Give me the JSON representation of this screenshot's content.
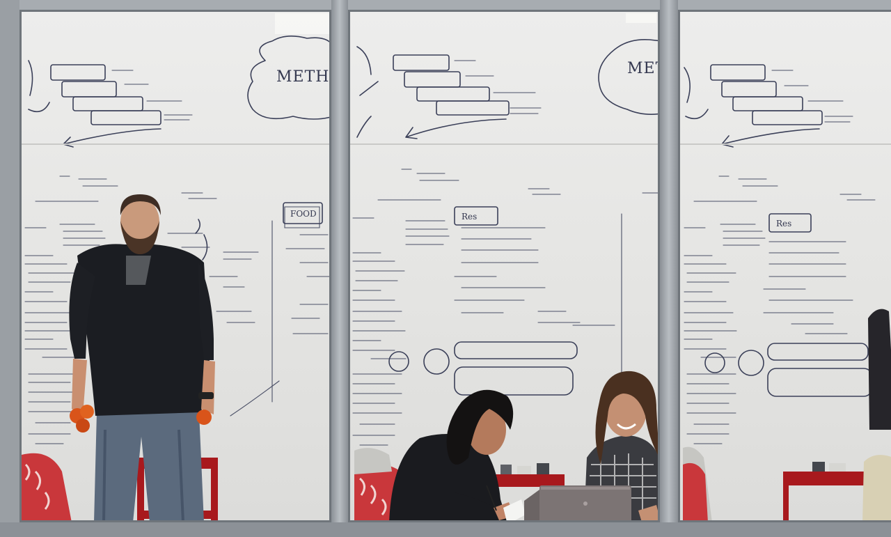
{
  "scene": {
    "whiteboard_words": {
      "pane1": "METHOD",
      "pane2": "METH"
    }
  },
  "colors": {
    "whiteboard": "#e8e8e6",
    "marker_ink": "#3a3f58",
    "window_frame": "#9a9fa4",
    "furniture_red": "#a8191d",
    "jacket": "#1b1d22",
    "jeans": "#5d6c80",
    "laptop": "#7c7474",
    "oranges": "#d9541a"
  },
  "icons": [
    "person-standing-juggling",
    "person-writing",
    "person-laughing",
    "laptop",
    "red-cart",
    "cushioned-chair"
  ]
}
